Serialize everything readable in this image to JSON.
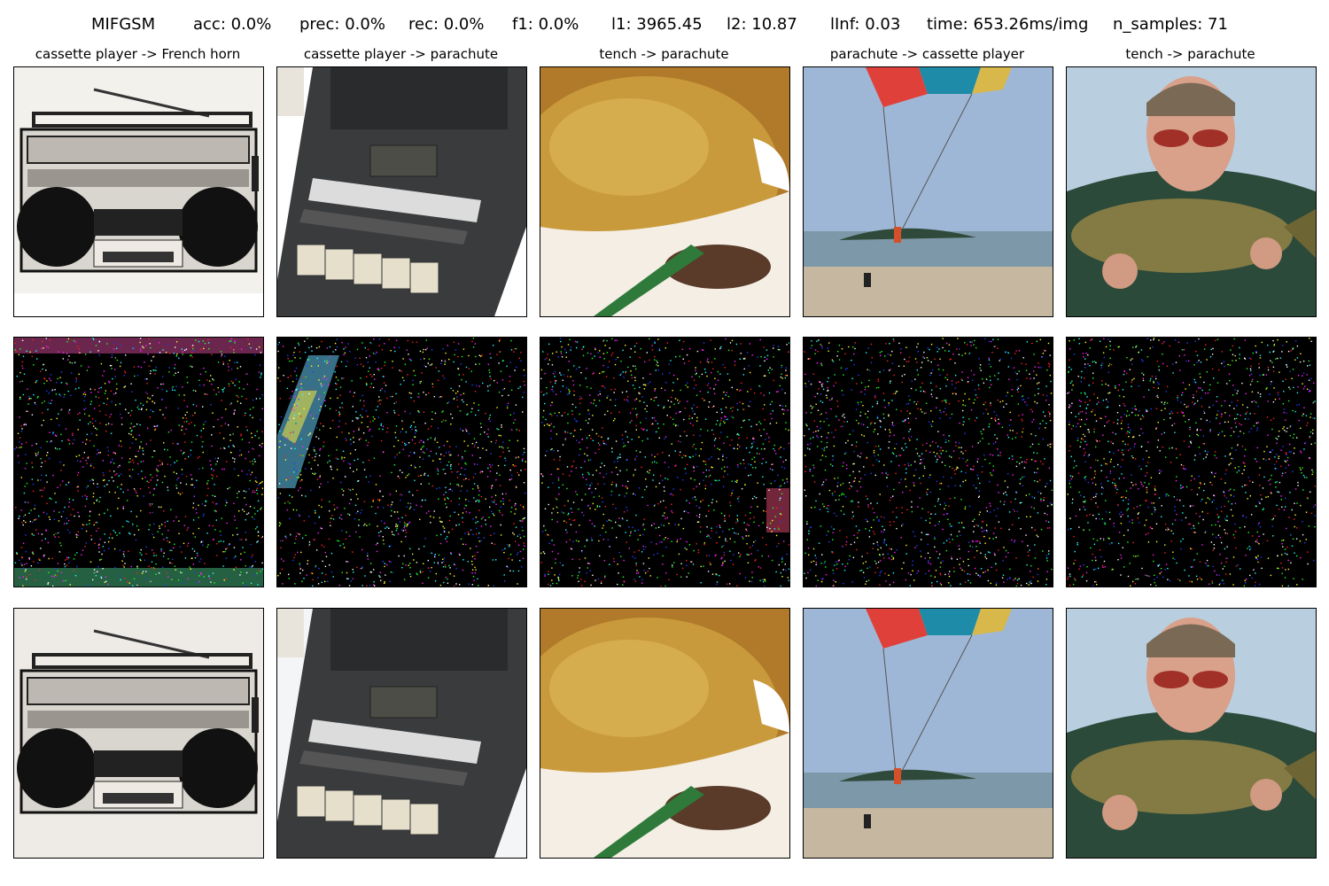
{
  "header": {
    "attack": "MIFGSM",
    "acc": "acc: 0.0%",
    "prec": "prec: 0.0%",
    "rec": "rec: 0.0%",
    "f1": "f1: 0.0%",
    "l1": "l1: 3965.45",
    "l2": "l2: 10.87",
    "linf": "lInf: 0.03",
    "time": "time: 653.26ms/img",
    "n_samples": "n_samples: 71"
  },
  "columns": [
    {
      "title": "cassette player -> French horn",
      "subject": "boombox"
    },
    {
      "title": "cassette player -> parachute",
      "subject": "commodore-datasette"
    },
    {
      "title": "tench -> parachute",
      "subject": "tench-closeup"
    },
    {
      "title": "parachute -> cassette player",
      "subject": "parasailing-beach"
    },
    {
      "title": "tench -> parachute",
      "subject": "man-holding-tench"
    }
  ],
  "rows": [
    "original",
    "perturbation",
    "adversarial"
  ]
}
